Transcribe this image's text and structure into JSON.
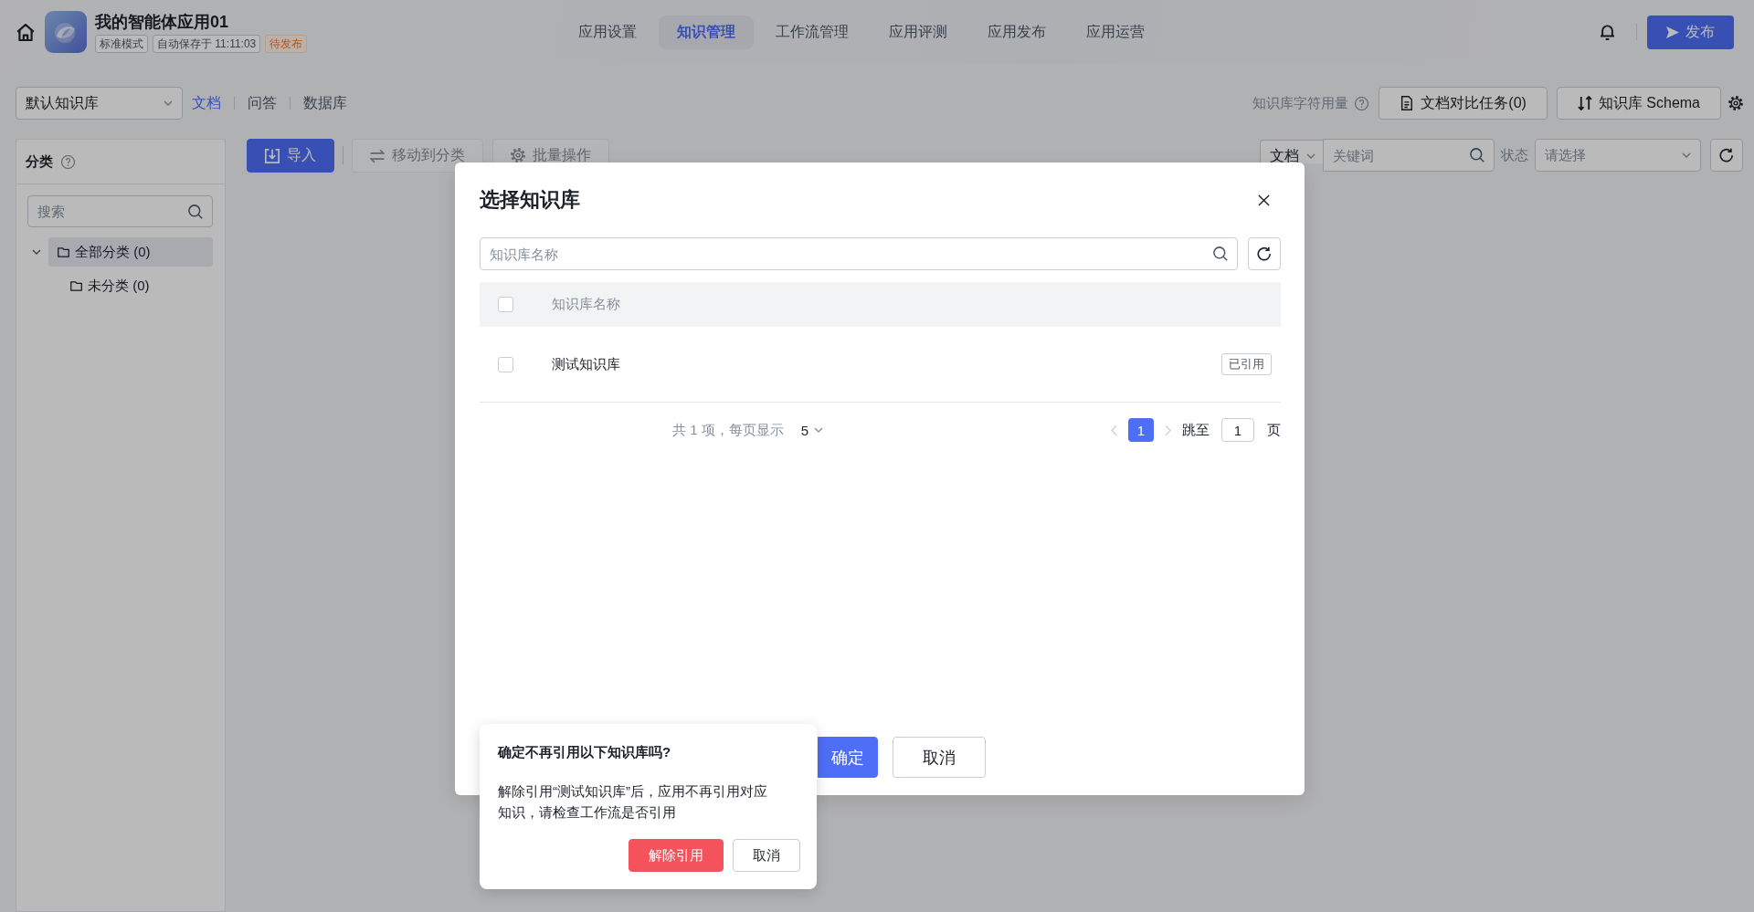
{
  "header": {
    "app_name": "我的智能体应用01",
    "tags": [
      {
        "label": "标准模式",
        "kind": "plain"
      },
      {
        "label": "自动保存于 11:11:03",
        "kind": "plain"
      },
      {
        "label": "待发布",
        "kind": "warning"
      }
    ],
    "nav_tabs": [
      {
        "label": "应用设置",
        "selected": false
      },
      {
        "label": "知识管理",
        "selected": true
      },
      {
        "label": "工作流管理",
        "selected": false
      },
      {
        "label": "应用评测",
        "selected": false
      },
      {
        "label": "应用发布",
        "selected": false
      },
      {
        "label": "应用运营",
        "selected": false
      }
    ],
    "publish_button": "发布"
  },
  "toolbar": {
    "knowledge_base_select": "默认知识库",
    "view_tabs": [
      {
        "label": "文档",
        "selected": true
      },
      {
        "label": "问答",
        "selected": false
      },
      {
        "label": "数据库",
        "selected": false
      }
    ],
    "usage_label": "知识库字符用量",
    "buttons": [
      {
        "label": "文档对比任务(0)",
        "kind": "tasks"
      },
      {
        "label": "知识库 Schema",
        "kind": "schema"
      }
    ]
  },
  "sidebar": {
    "title": "分类",
    "search": {
      "placeholder": "搜索"
    },
    "tree": [
      {
        "label": "全部分类 (0)",
        "selected": true,
        "expanded": true,
        "children": [
          {
            "label": "未分类 (0)",
            "selected": false
          }
        ]
      }
    ]
  },
  "content": {
    "actions": [
      {
        "label": "导入",
        "kind": "import",
        "disabled": false
      },
      {
        "label": "移动到分类",
        "kind": "move",
        "disabled": true
      },
      {
        "label": "批量操作",
        "kind": "batch",
        "disabled": true
      }
    ],
    "type_select": "文档",
    "keyword": {
      "placeholder": "关键词"
    },
    "status_label": "状态",
    "status_select": {
      "placeholder": "请选择"
    }
  },
  "dialog": {
    "title": "选择知识库",
    "search": {
      "placeholder": "知识库名称"
    },
    "table": {
      "columns": [
        "知识库名称"
      ],
      "header_checked": false,
      "rows": [
        {
          "name": "测试知识库",
          "checked": false,
          "tag": "已引用"
        }
      ]
    },
    "pagination": {
      "summary": "共 1 项，每页显示",
      "page_size": "5",
      "pages": [
        {
          "label": "1",
          "selected": true
        }
      ],
      "jump_label": "跳至",
      "jump_value": "1",
      "page_suffix": "页"
    },
    "buttons": [
      {
        "label": "确定",
        "kind": "primary"
      },
      {
        "label": "取消",
        "kind": "default"
      }
    ]
  },
  "popconfirm": {
    "title": "确定不再引用以下知识库吗?",
    "message": "解除引用“测试知识库”后，应用不再引用对应知识，请检查工作流是否引用",
    "buttons": [
      {
        "label": "解除引用",
        "kind": "danger"
      },
      {
        "label": "取消",
        "kind": "default"
      }
    ]
  }
}
